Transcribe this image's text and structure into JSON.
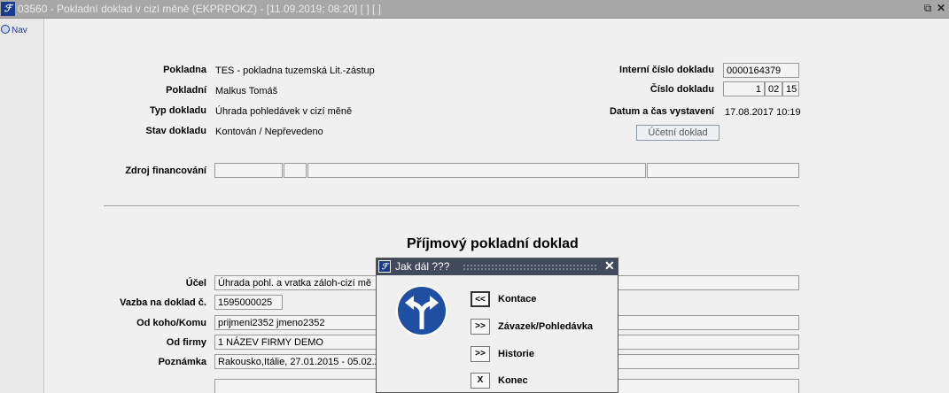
{
  "window": {
    "app_icon": "ef-logo",
    "title": "03560 - Pokladní doklad v cizí měně (EKPRPOKZ) - [11.09.2019; 08:20]  [ ]  [ ]",
    "restore_icon": "restore-window-icon",
    "close_icon": "close-icon"
  },
  "nav": {
    "label": "Nav"
  },
  "header": {
    "pokladna_label": "Pokladna",
    "pokladna_value": "TES - pokladna tuzemská Lit.-zástup",
    "pokladni_label": "Pokladní",
    "pokladni_value": "Malkus Tomáš",
    "typ_label": "Typ dokladu",
    "typ_value": "Úhrada pohledávek v cizí měně",
    "stav_label": "Stav dokladu",
    "stav_value": "Kontován / Nepřevedeno",
    "interni_label": "Interní číslo dokladu",
    "interni_value": "0000164379",
    "cislo_label": "Číslo dokladu",
    "cislo_1": "1",
    "cislo_2": "02",
    "cislo_3": "15",
    "datum_label": "Datum a čas vystavení",
    "datum_value": "17.08.2017 10:19",
    "ucetni_button": "Účetní doklad",
    "zdroj_label": "Zdroj financování"
  },
  "form": {
    "heading": "Příjmový pokladní doklad",
    "ucel_label": "Účel",
    "ucel_value": "Úhrada pohl. a vratka záloh-cizí mě",
    "vazba_label": "Vazba na doklad č.",
    "vazba_value": "1595000025",
    "odkoho_label": "Od koho/Komu",
    "odkoho_value": "prijmeni2352 jmeno2352",
    "odfirmy_label": "Od firmy",
    "odfirmy_value": "1 NÁZEV FIRMY DEMO",
    "poznamka_label": "Poznámka",
    "poznamka_value": "Rakousko,Itálie, 27.01.2015 - 05.02.20"
  },
  "dialog": {
    "title": "Jak dál ???",
    "close": "✕",
    "sign_icon": "fork-arrow-sign-icon",
    "options": [
      {
        "btn": "<<",
        "label": "Kontace"
      },
      {
        "btn": ">>",
        "label": "Závazek/Pohledávka"
      },
      {
        "btn": ">>",
        "label": "Historie"
      },
      {
        "btn": "X",
        "label": "Konec"
      }
    ]
  }
}
